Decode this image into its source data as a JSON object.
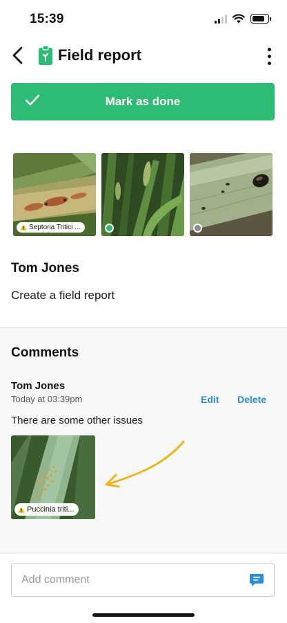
{
  "status_bar": {
    "time": "15:39",
    "battery_level": 0.8,
    "signal_bars": 2
  },
  "header": {
    "title": "Field report",
    "back_icon": "chevron-left-icon",
    "menu_icon": "more-vertical-icon",
    "title_icon": "clipboard-plant-icon"
  },
  "actions": {
    "mark_done_label": "Mark as done",
    "mark_done_icon": "check-icon",
    "accent_color": "#2dbb76"
  },
  "photos": [
    {
      "tag": "Septoria Tritici ...",
      "status": "warning"
    },
    {
      "tag": "",
      "status": "complete"
    },
    {
      "tag": "",
      "status": "pending"
    }
  ],
  "report": {
    "author": "Tom Jones",
    "description": "Create a field report"
  },
  "comments": {
    "title": "Comments",
    "items": [
      {
        "author": "Tom Jones",
        "time": "Today at 03:39pm",
        "edit_label": "Edit",
        "delete_label": "Delete",
        "text": "There are some other issues",
        "photo_tag": "Puccinia triti..."
      }
    ]
  },
  "input": {
    "placeholder": "Add comment",
    "value": "",
    "send_icon": "chat-send-icon"
  },
  "colors": {
    "link": "#2a8ee0",
    "warning": "#f5b400",
    "annotation_arrow": "#f3b21b"
  }
}
